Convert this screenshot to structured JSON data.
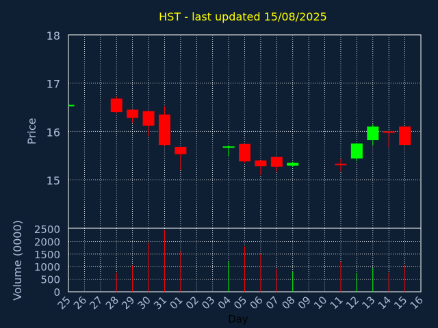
{
  "chart_data": [
    {
      "type": "candlestick",
      "title": "HST - last updated 15/08/2025",
      "ylabel": "Price",
      "ylim": [
        15,
        18
      ],
      "y_ticks": [
        15,
        16,
        17,
        18
      ],
      "x_ticks": [
        "25",
        "26",
        "27",
        "28",
        "29",
        "30",
        "31",
        "01",
        "02",
        "03",
        "04",
        "05",
        "06",
        "07",
        "08",
        "09",
        "10",
        "11",
        "12",
        "13",
        "14",
        "15",
        "16"
      ],
      "grid": true,
      "candles": [
        {
          "day": "25",
          "open": 16.55,
          "high": 16.55,
          "low": 16.55,
          "close": 16.55
        },
        {
          "day": "28",
          "open": 16.68,
          "high": 16.72,
          "low": 16.38,
          "close": 16.4
        },
        {
          "day": "29",
          "open": 16.45,
          "high": 16.45,
          "low": 16.18,
          "close": 16.28
        },
        {
          "day": "30",
          "open": 16.42,
          "high": 16.42,
          "low": 15.9,
          "close": 16.12
        },
        {
          "day": "31",
          "open": 16.35,
          "high": 16.52,
          "low": 15.7,
          "close": 15.72
        },
        {
          "day": "01",
          "open": 15.68,
          "high": 15.68,
          "low": 15.2,
          "close": 15.53
        },
        {
          "day": "04",
          "open": 15.67,
          "high": 15.72,
          "low": 15.48,
          "close": 15.69
        },
        {
          "day": "05",
          "open": 15.74,
          "high": 15.74,
          "low": 15.35,
          "close": 15.38
        },
        {
          "day": "06",
          "open": 15.4,
          "high": 15.4,
          "low": 15.1,
          "close": 15.28
        },
        {
          "day": "07",
          "open": 15.47,
          "high": 15.47,
          "low": 15.17,
          "close": 15.27
        },
        {
          "day": "08",
          "open": 15.29,
          "high": 15.37,
          "low": 15.27,
          "close": 15.35
        },
        {
          "day": "11",
          "open": 15.33,
          "high": 15.43,
          "low": 15.18,
          "close": 15.31
        },
        {
          "day": "12",
          "open": 15.44,
          "high": 15.76,
          "low": 15.38,
          "close": 15.75
        },
        {
          "day": "13",
          "open": 15.82,
          "high": 16.15,
          "low": 15.72,
          "close": 16.1
        },
        {
          "day": "14",
          "open": 16.0,
          "high": 16.0,
          "low": 15.68,
          "close": 15.98
        },
        {
          "day": "15",
          "open": 16.1,
          "high": 16.1,
          "low": 15.72,
          "close": 15.72
        }
      ],
      "colors": {
        "up": "#00ff00",
        "down": "#ff0000"
      }
    },
    {
      "type": "bar",
      "ylabel": "Volume (0000)",
      "xlabel": "Day",
      "ylim": [
        0,
        2500
      ],
      "y_ticks": [
        0,
        500,
        1000,
        1500,
        2000,
        2500
      ],
      "series": [
        {
          "day": "25",
          "value": 0,
          "direction": "none"
        },
        {
          "day": "28",
          "value": 750,
          "direction": "down"
        },
        {
          "day": "29",
          "value": 1050,
          "direction": "down"
        },
        {
          "day": "30",
          "value": 1950,
          "direction": "down"
        },
        {
          "day": "31",
          "value": 2450,
          "direction": "down"
        },
        {
          "day": "01",
          "value": 1600,
          "direction": "down"
        },
        {
          "day": "04",
          "value": 1200,
          "direction": "up"
        },
        {
          "day": "05",
          "value": 1800,
          "direction": "down"
        },
        {
          "day": "06",
          "value": 1500,
          "direction": "down"
        },
        {
          "day": "07",
          "value": 900,
          "direction": "down"
        },
        {
          "day": "08",
          "value": 800,
          "direction": "up"
        },
        {
          "day": "11",
          "value": 1200,
          "direction": "down"
        },
        {
          "day": "12",
          "value": 750,
          "direction": "up"
        },
        {
          "day": "13",
          "value": 950,
          "direction": "up"
        },
        {
          "day": "14",
          "value": 750,
          "direction": "down"
        },
        {
          "day": "15",
          "value": 1050,
          "direction": "down"
        }
      ]
    }
  ],
  "theme": {
    "background": "#0f1f33",
    "axis_text": "#a9bdd6",
    "title_color": "#ffff00",
    "frame": "#ffffff",
    "grid": "#ffffff"
  }
}
